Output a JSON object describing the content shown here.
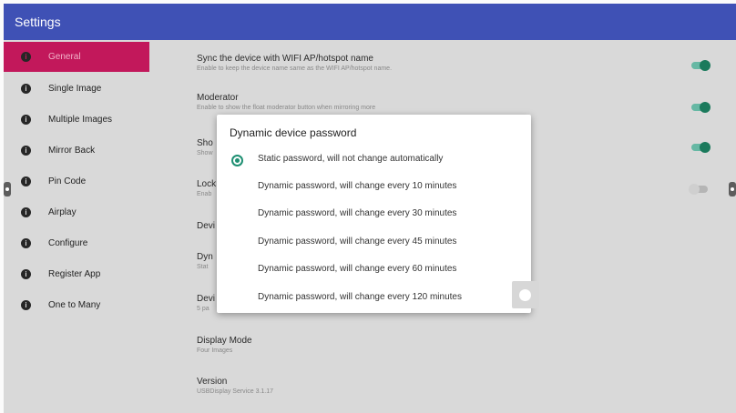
{
  "header": {
    "title": "Settings"
  },
  "sidebar": {
    "items": [
      {
        "label": "General",
        "active": true
      },
      {
        "label": "Single Image"
      },
      {
        "label": "Multiple Images"
      },
      {
        "label": "Mirror Back"
      },
      {
        "label": "Pin Code"
      },
      {
        "label": "Airplay"
      },
      {
        "label": "Configure"
      },
      {
        "label": "Register App"
      },
      {
        "label": "One to Many"
      }
    ]
  },
  "settings": [
    {
      "title": "Sync the device with WIFI AP/hotspot name",
      "subtitle": "Enable to keep the device name same as the WIFI AP/hotspot name.",
      "toggle": "on"
    },
    {
      "title": "Moderator",
      "subtitle": "Enable to show the float moderator button when mirroring more",
      "toggle": "on"
    },
    {
      "title": "Sho",
      "subtitle": "Show",
      "toggle": "on"
    },
    {
      "title": "Lock",
      "subtitle": "Enab",
      "toggle": "off"
    },
    {
      "title": "Devi",
      "subtitle": ""
    },
    {
      "title": "Dyn",
      "subtitle": "Stat"
    },
    {
      "title": "Devi",
      "subtitle": "5 pa"
    },
    {
      "title": "Display Mode",
      "subtitle": "Four Images"
    },
    {
      "title": "Version",
      "subtitle": "USBDisplay Service 3.1.17"
    }
  ],
  "dialog": {
    "title": "Dynamic device password",
    "selected_index": 0,
    "options": [
      "Static password, will not change automatically",
      "Dynamic password, will change every 10 minutes",
      "Dynamic password, will change every 30 minutes",
      "Dynamic password, will change every 45 minutes",
      "Dynamic password, will change every 60 minutes",
      "Dynamic password, will change every 120 minutes"
    ]
  },
  "colors": {
    "topbar": "#3f51b5",
    "active_item": "#c2185b",
    "accent": "#1e8f72"
  },
  "icons": {
    "nav": "info-icon"
  }
}
